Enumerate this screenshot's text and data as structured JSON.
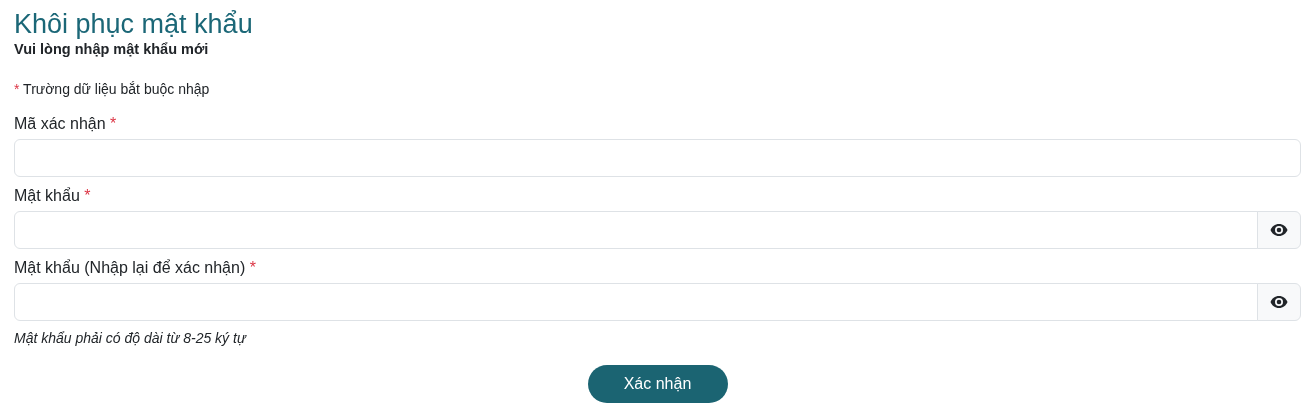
{
  "title": "Khôi phục mật khẩu",
  "subtitle": "Vui lòng nhập mật khẩu mới",
  "required_note": {
    "mark": "*",
    "text": "Trường dữ liệu bắt buộc nhập"
  },
  "fields": [
    {
      "label": "Mã xác nhận",
      "required_mark": "*",
      "kind": "text"
    },
    {
      "label": "Mật khẩu",
      "required_mark": "*",
      "kind": "password"
    },
    {
      "label": "Mật khẩu (Nhập lại để xác nhận)",
      "required_mark": "*",
      "kind": "password"
    }
  ],
  "hint": "Mật khẩu phải có độ dài từ 8-25 ký tự",
  "submit": "Xác nhận"
}
